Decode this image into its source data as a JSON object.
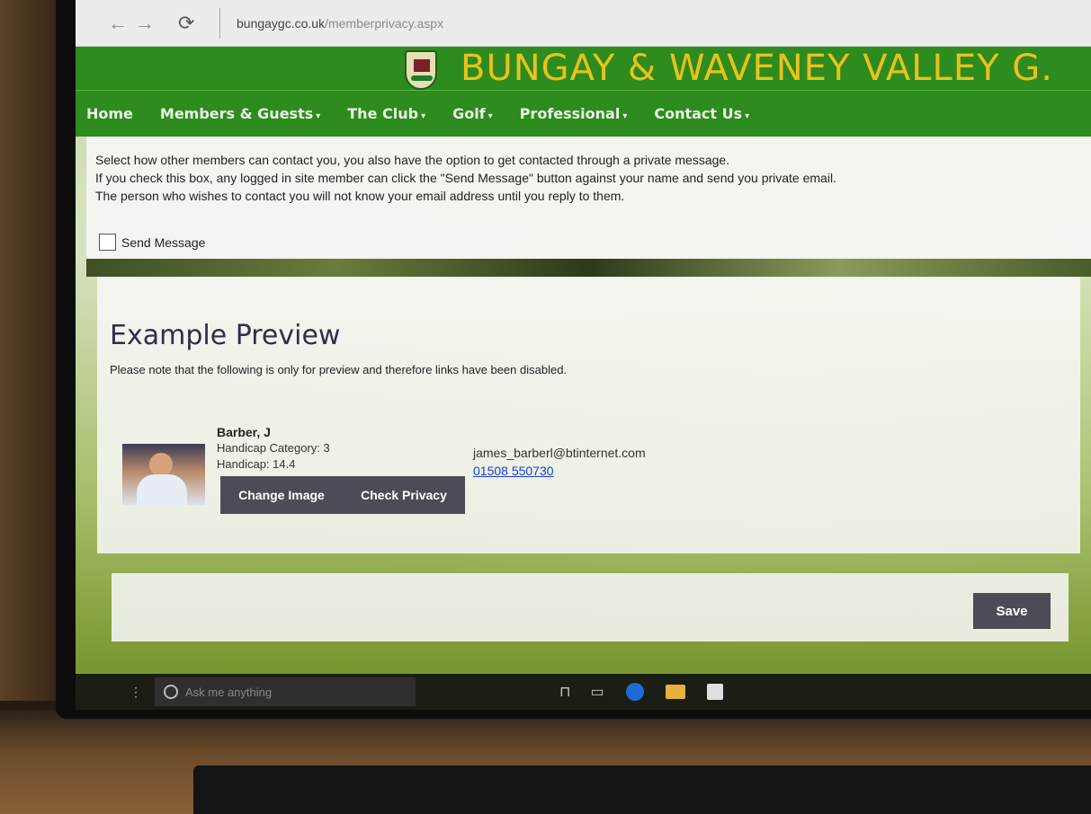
{
  "browser": {
    "back_icon": "←",
    "forward_icon": "→",
    "refresh_icon": "⟳",
    "url_domain": "bungaygc.co.uk",
    "url_path": "/memberprivacy.aspx"
  },
  "site": {
    "title": "BUNGAY & WAVENEY VALLEY G.",
    "colors": {
      "header_green": "#2e8b1e",
      "title_gold": "#e8c21c"
    }
  },
  "nav": {
    "items": [
      {
        "label": "Home",
        "caret": ""
      },
      {
        "label": "Members & Guests",
        "caret": "▾"
      },
      {
        "label": "The Club",
        "caret": "▾"
      },
      {
        "label": "Golf",
        "caret": "▾"
      },
      {
        "label": "Professional",
        "caret": "▾"
      },
      {
        "label": "Contact Us",
        "caret": "▾"
      }
    ]
  },
  "privacy": {
    "lines": [
      "Select how other members can contact you, you also have the option to get contacted through a private message.",
      "If you check this box, any logged in site member can click the \"Send Message\" button against your name and send you private email.",
      "The person who wishes to contact you will not know your email address until you reply to them."
    ],
    "checkbox_label": "Send Message",
    "checkbox_checked": false
  },
  "preview": {
    "title": "Example Preview",
    "note": "Please note that the following is only for preview and therefore links have been disabled.",
    "member": {
      "name": "Barber, J",
      "handicap_category": "Handicap Category: 3",
      "handicap": "Handicap: 14.4",
      "email": "james_barberl@btinternet.com",
      "phone": "01508 550730"
    },
    "buttons": {
      "change_image": "Change Image",
      "check_privacy": "Check Privacy"
    }
  },
  "save": {
    "label": "Save"
  },
  "taskbar": {
    "search_placeholder": "Ask me anything",
    "task_view_icon": "⊓",
    "multitask_icon": "▭"
  }
}
